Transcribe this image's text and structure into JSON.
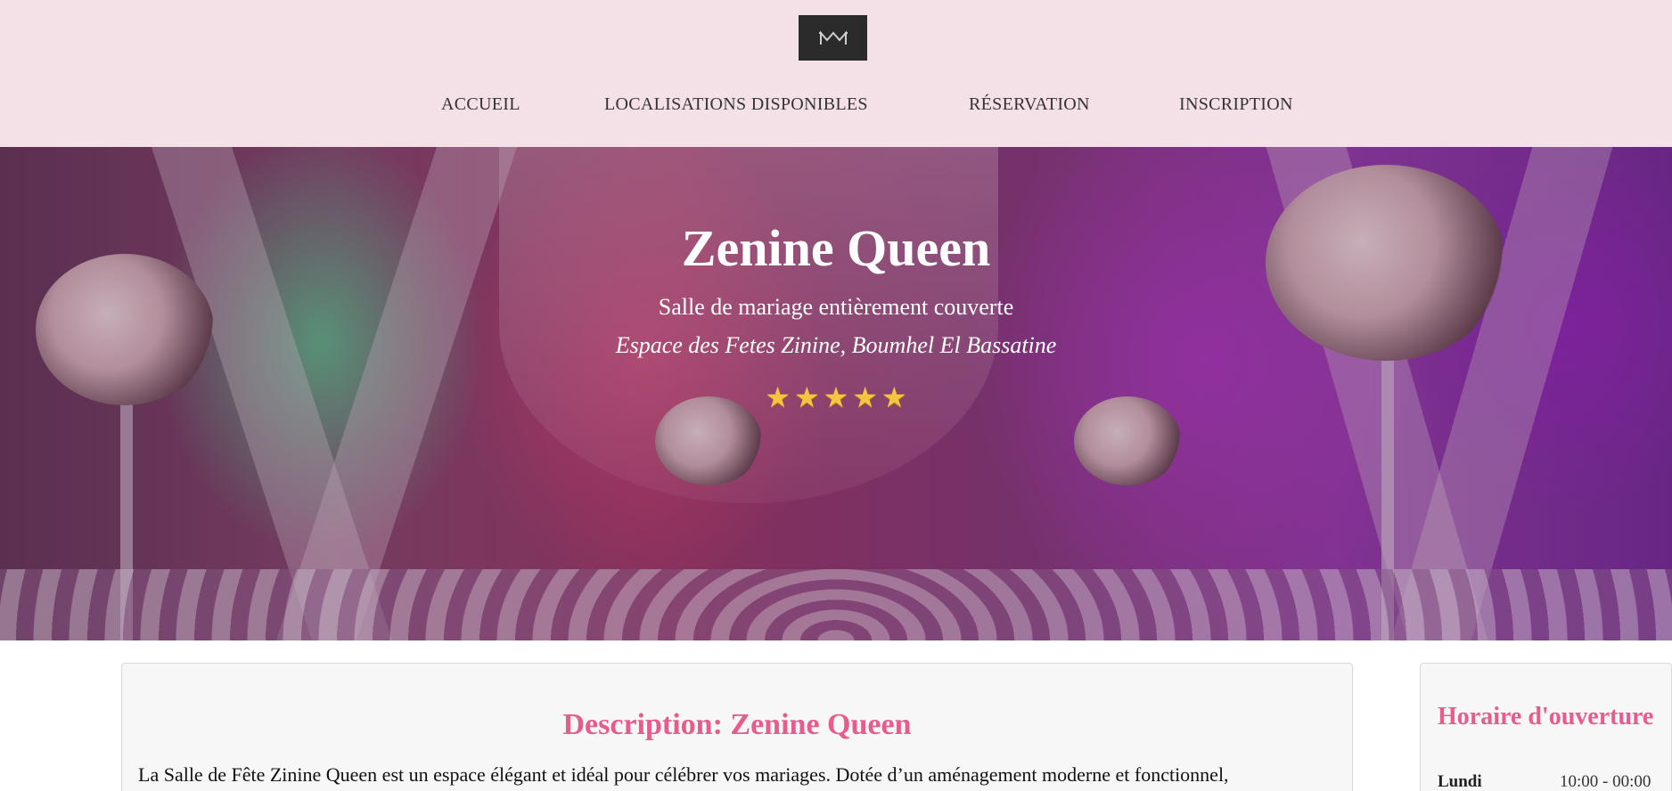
{
  "header": {
    "logo_icon": "stylized-m-logo-icon",
    "nav": [
      {
        "label": "ACCUEIL"
      },
      {
        "label": "LOCALISATIONS DISPONIBLES"
      },
      {
        "label": "RÉSERVATION"
      },
      {
        "label": "INSCRIPTION"
      }
    ]
  },
  "hero": {
    "title": "Zenine Queen",
    "subtitle": "Salle de mariage entièrement couverte",
    "location": "Espace des Fetes Zinine, Boumhel El Bassatine",
    "rating": 5,
    "star_glyph": "★"
  },
  "description": {
    "title": "Description: Zenine Queen",
    "text": "La Salle de Fête Zinine Queen est un espace élégant et idéal pour célébrer vos mariages. Dotée d’un aménagement moderne et fonctionnel,"
  },
  "hours": {
    "title": "Horaire d'ouverture",
    "rows": [
      {
        "day": "Lundi",
        "time": "10:00 - 00:00"
      }
    ]
  },
  "colors": {
    "header_bg": "#f4e1e7",
    "accent": "#e75c8d",
    "logo_bg": "#2b2b2b",
    "star": "#f5c542"
  }
}
